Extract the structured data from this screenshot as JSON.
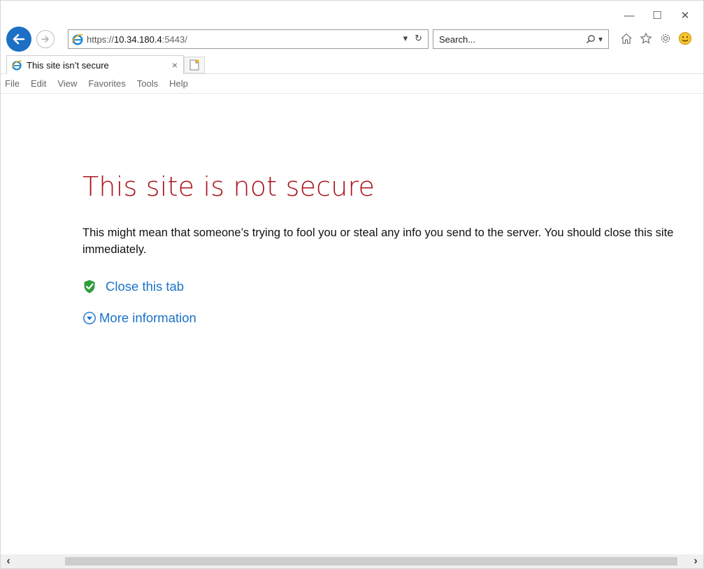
{
  "window": {
    "controls": {
      "minimize": "—",
      "maximize": "☐",
      "close": "✕"
    }
  },
  "address_bar": {
    "url_scheme": "https://",
    "url_host": "10.34.180.4",
    "url_rest": ":5443/",
    "dropdown": "▾",
    "refresh": "↻"
  },
  "search": {
    "placeholder": "Search...",
    "dropdown": "▾"
  },
  "tab": {
    "title": "This site isn’t secure",
    "close": "×"
  },
  "menu": {
    "items": [
      "File",
      "Edit",
      "View",
      "Favorites",
      "Tools",
      "Help"
    ]
  },
  "page": {
    "title": "This site is not secure",
    "description": "This might mean that someone’s trying to fool you or steal any info you send to the server. You should close this site immediately.",
    "close_tab_link": "Close this tab",
    "more_info_link": "More information"
  },
  "scrollbar": {
    "left": "‹",
    "right": "›"
  },
  "colors": {
    "title_red": "#a8141b",
    "link_blue": "#1a73c9",
    "back_button": "#1c6fc4",
    "shield_green": "#2e9d3b"
  },
  "icons": {
    "back": "back-arrow-icon",
    "forward": "forward-arrow-icon",
    "ie": "ie-logo-icon",
    "search": "search-icon",
    "home": "home-icon",
    "favorites": "star-icon",
    "settings": "gear-icon",
    "feedback": "smiley-icon",
    "shield": "shield-check-icon",
    "expand": "chevron-circle-down-icon",
    "new_tab": "new-tab-icon"
  }
}
